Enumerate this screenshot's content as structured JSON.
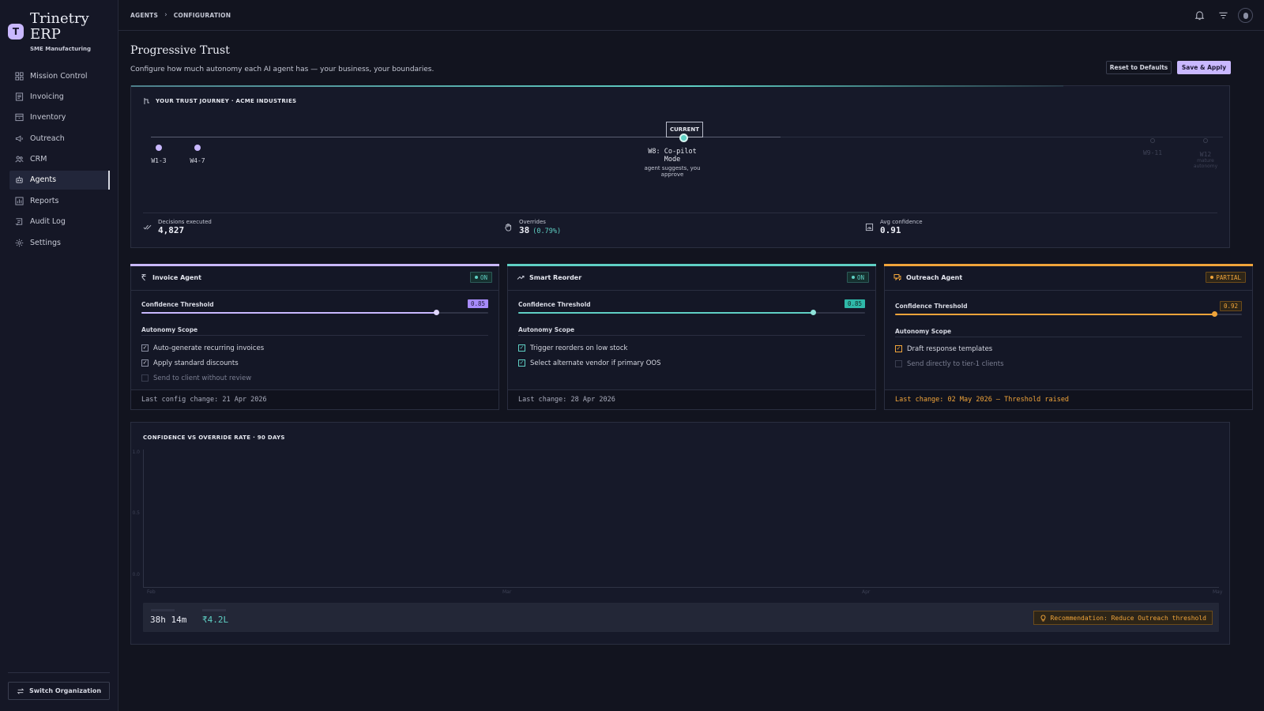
{
  "brand": {
    "name_line1": "Trinetry",
    "name_line2": "ERP",
    "logo_letter": "T",
    "subtitle": "SME Manufacturing"
  },
  "sidebar": {
    "items": [
      {
        "label": "Mission Control",
        "icon": "grid-icon"
      },
      {
        "label": "Invoicing",
        "icon": "invoice-icon"
      },
      {
        "label": "Inventory",
        "icon": "box-icon"
      },
      {
        "label": "Outreach",
        "icon": "megaphone-icon"
      },
      {
        "label": "CRM",
        "icon": "users-icon"
      },
      {
        "label": "Agents",
        "icon": "robot-icon",
        "active": true
      },
      {
        "label": "Reports",
        "icon": "chart-icon"
      },
      {
        "label": "Audit Log",
        "icon": "history-icon"
      },
      {
        "label": "Settings",
        "icon": "gear-icon"
      }
    ],
    "switch_label": "Switch Organization"
  },
  "breadcrumb": {
    "first": "AGENTS",
    "second": "CONFIGURATION"
  },
  "page": {
    "title": "Progressive Trust",
    "subtitle": "Configure how much autonomy each AI agent has — your business, your boundaries.",
    "reset_label": "Reset to Defaults",
    "save_label": "Save & Apply"
  },
  "journey": {
    "title": "YOUR TRUST JOURNEY · ACME INDUSTRIES",
    "current_badge": "CURRENT",
    "milestones": [
      {
        "label": "W1-3"
      },
      {
        "label": "W4-7"
      },
      {
        "label": "W8: Co-pilot Mode",
        "desc": "agent suggests, you approve"
      },
      {
        "label": "W9-11"
      },
      {
        "label": "W12",
        "desc": "mature autonomy"
      }
    ],
    "stats": [
      {
        "label": "Decisions executed",
        "value": "4,827",
        "extra": ""
      },
      {
        "label": "Overrides",
        "value": "38",
        "extra": "(0.79%)"
      },
      {
        "label": "Avg confidence",
        "value": "0.91",
        "extra": ""
      }
    ]
  },
  "agents": [
    {
      "name": "Invoice Agent",
      "status": "ON",
      "color": "#c9b8ff",
      "threshold_label": "Confidence Threshold",
      "threshold_text": "0.85",
      "threshold": 0.85,
      "scope_label": "Autonomy Scope",
      "scope": [
        {
          "label": "Auto-generate recurring invoices",
          "checked": true
        },
        {
          "label": "Apply standard discounts",
          "checked": true
        },
        {
          "label": "Send to client without review",
          "checked": false
        }
      ],
      "footer": "Last config change: 21 Apr 2026"
    },
    {
      "name": "Smart Reorder",
      "status": "ON",
      "color": "#5fd0c4",
      "threshold_label": "Confidence Threshold",
      "threshold_text": "0.85",
      "threshold": 0.85,
      "scope_label": "Autonomy Scope",
      "scope": [
        {
          "label": "Trigger reorders on low stock",
          "checked": true
        },
        {
          "label": "Select alternate vendor if primary OOS",
          "checked": true
        }
      ],
      "footer": "Last change: 28 Apr 2026"
    },
    {
      "name": "Outreach Agent",
      "status": "PARTIAL",
      "color": "#f0a43a",
      "threshold_label": "Confidence Threshold",
      "threshold_text": "0.92",
      "threshold": 0.92,
      "scope_label": "Autonomy Scope",
      "scope": [
        {
          "label": "Draft response templates",
          "checked": true
        },
        {
          "label": "Send directly to tier-1 clients",
          "checked": false
        }
      ],
      "footer": "Last change: 02 May 2026 — Threshold raised"
    }
  ],
  "chart": {
    "title": "CONFIDENCE VS OVERRIDE RATE · 90 DAYS",
    "time_saved": "38h 14m",
    "value_saved": "₹4.2L",
    "recommendation": "Recommendation: Reduce Outreach threshold"
  },
  "chart_data": {
    "type": "line",
    "title": "CONFIDENCE VS OVERRIDE RATE · 90 DAYS",
    "x_ticks": [
      "Feb",
      "Mar",
      "Apr",
      "May"
    ],
    "y_ticks": [
      "1.0",
      "0.5",
      "0.0"
    ],
    "ylim": [
      0,
      1
    ],
    "series": []
  },
  "colors": {
    "accent": "#c9b8ff",
    "teal": "#5fd0c4",
    "amber": "#f0a43a",
    "bg": "#12141f"
  }
}
